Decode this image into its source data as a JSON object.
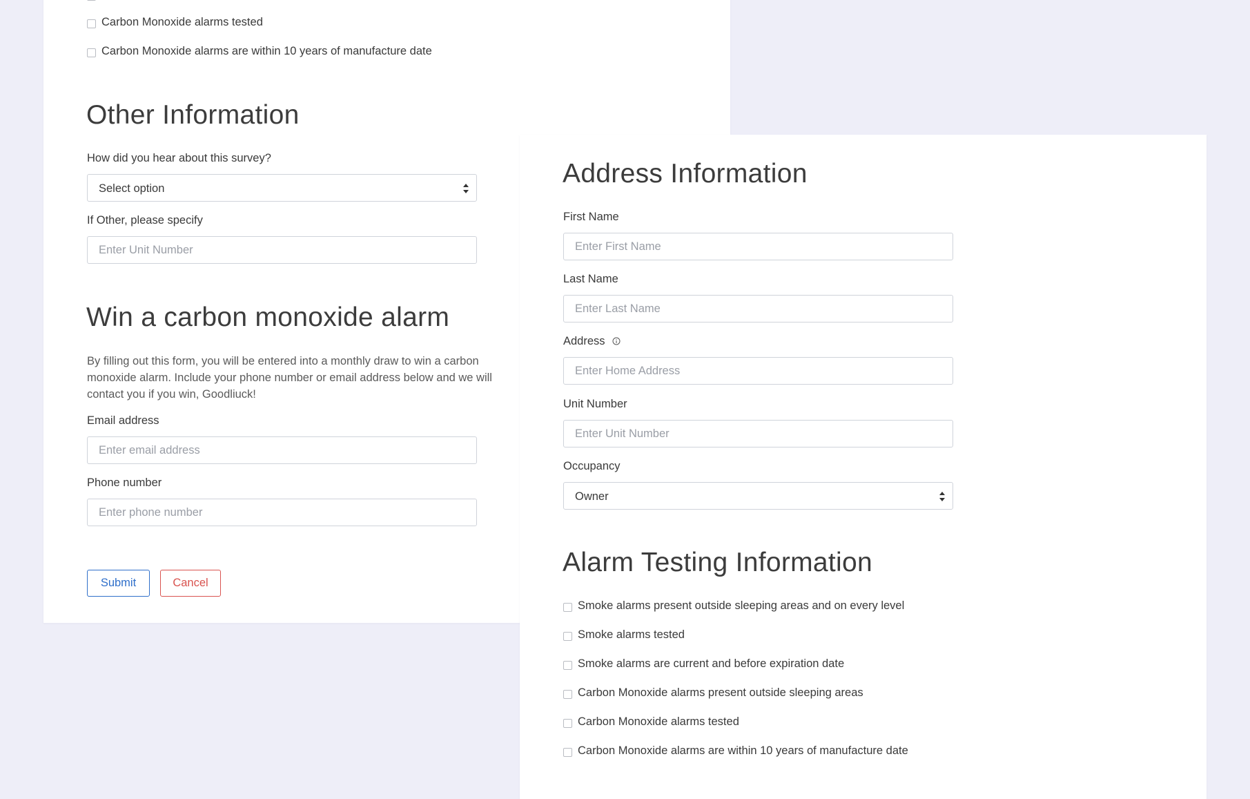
{
  "back_card": {
    "alarm_checks": [
      {
        "label": "Carbon Monoxide alarms tested"
      },
      {
        "label": "Carbon Monoxide alarms are within 10 years of manufacture date"
      }
    ],
    "other_info": {
      "title": "Other Information",
      "hear_label": "How did you hear about this survey?",
      "hear_value": "Select option",
      "other_label": "If Other, please specify",
      "other_placeholder": "Enter Unit Number"
    },
    "win": {
      "title": "Win a carbon monoxide alarm",
      "description": "By filling out this form, you will be entered into a monthly draw to win a carbon monoxide alarm. Include your phone number or email address below and we will contact you if you win, Goodliuck!",
      "email_label": "Email address",
      "email_placeholder": "Enter email address",
      "phone_label": "Phone number",
      "phone_placeholder": "Enter phone number"
    },
    "buttons": {
      "submit": "Submit",
      "cancel": "Cancel"
    }
  },
  "front_card": {
    "address": {
      "title": "Address Information",
      "first_name_label": "First Name",
      "first_name_placeholder": "Enter First Name",
      "last_name_label": "Last Name",
      "last_name_placeholder": "Enter Last Name",
      "address_label": "Address",
      "address_placeholder": "Enter Home Address",
      "unit_label": "Unit Number",
      "unit_placeholder": "Enter Unit Number",
      "occupancy_label": "Occupancy",
      "occupancy_value": "Owner"
    },
    "alarm_testing": {
      "title": "Alarm Testing Information",
      "checks": [
        {
          "label": "Smoke alarms present outside sleeping areas and on every level"
        },
        {
          "label": "Smoke alarms tested"
        },
        {
          "label": "Smoke alarms are current and before expiration date"
        },
        {
          "label": "Carbon Monoxide alarms present outside sleeping areas"
        },
        {
          "label": "Carbon Monoxide alarms tested"
        },
        {
          "label": "Carbon Monoxide alarms are within 10 years of manufacture date"
        }
      ]
    }
  },
  "colors": {
    "background": "#eeeef8",
    "submit": "#2f6fca",
    "cancel": "#d9534f"
  },
  "icons": {
    "address_info": "info-circle-icon",
    "select_arrows": "sort-arrows-icon"
  }
}
